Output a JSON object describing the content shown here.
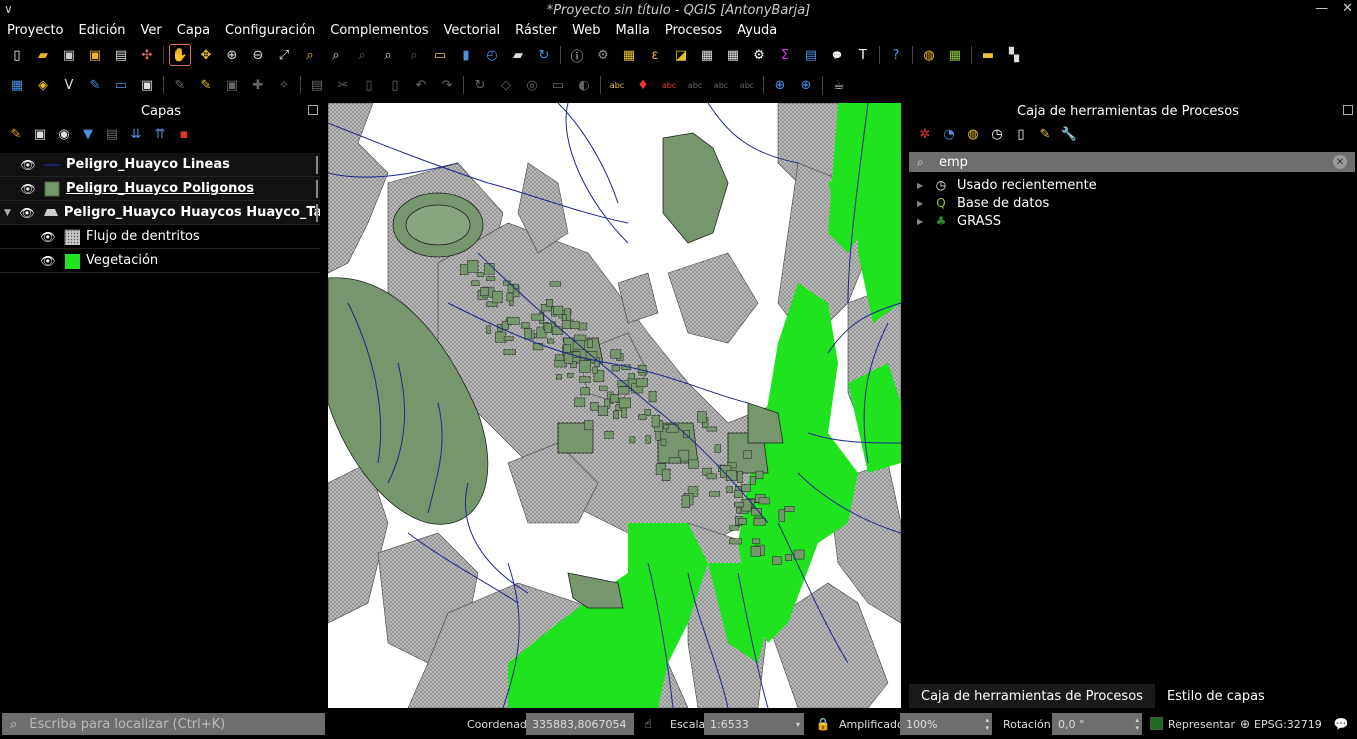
{
  "window": {
    "title": "*Proyecto sin título - QGIS [AntonyBarja]",
    "menu_glyph": "∨",
    "minimize": "—",
    "close": "✕"
  },
  "menu": {
    "items": [
      "Proyecto",
      "Edición",
      "Ver",
      "Capa",
      "Configuración",
      "Complementos",
      "Vectorial",
      "Ráster",
      "Web",
      "Malla",
      "Procesos",
      "Ayuda"
    ]
  },
  "toolbar1": {
    "icons": [
      "new-project-icon",
      "open-project-icon",
      "save-project-icon",
      "save-as-icon",
      "print-layout-icon",
      "style-manager-icon",
      "pan-icon",
      "pan-to-selection-icon",
      "zoom-in-icon",
      "zoom-out-icon",
      "zoom-full-icon",
      "zoom-to-selection-icon",
      "zoom-to-layer-icon",
      "zoom-last-icon",
      "zoom-native-icon",
      "zoom-next-icon",
      "new-map-view-icon",
      "new-3d-view-icon",
      "temporal-icon",
      "bookmarks-icon",
      "refresh-icon",
      "identify-icon",
      "measure-icon",
      "select-features-icon",
      "select-by-value-icon",
      "deselect-icon",
      "attribute-table-icon",
      "field-calculator-icon",
      "processing-toolbox-icon",
      "statistics-icon",
      "map-tips-icon",
      "annotation-icon",
      "text-annotation-icon",
      "help-icon",
      "python-console-icon",
      "plugin-icon",
      "db-manager-icon",
      "overview-icon"
    ]
  },
  "toolbar2": {
    "icons": [
      "data-source-manager-icon",
      "new-geopackage-icon",
      "new-shapefile-icon",
      "new-spatialite-icon",
      "new-virtual-layer-icon",
      "new-temp-layer-icon",
      "edit-toggle-icon",
      "digitize-icon",
      "save-edits-icon",
      "add-feature-icon",
      "vertex-tool-icon",
      "delete-icon",
      "cut-icon",
      "copy-icon",
      "paste-icon",
      "undo-icon",
      "redo-icon",
      "rotate-icon",
      "simplify-icon",
      "add-ring-icon",
      "add-part-icon",
      "fill-ring-icon",
      "label-icon",
      "pin-label-icon",
      "show-label-icon",
      "move-label-icon",
      "rotate-label-icon",
      "change-label-icon",
      "globe-icon",
      "wms-icon",
      "coffee-icon"
    ]
  },
  "layers_panel": {
    "title": "Capas",
    "layers": [
      {
        "name": "Peligro_Huayco Lineas",
        "symbol": "line",
        "color": "#1b2a8a",
        "bold": true,
        "underline": false
      },
      {
        "name": "Peligro_Huayco Poligonos",
        "symbol": "fill",
        "color": "#76966e",
        "bold": true,
        "underline": true
      },
      {
        "name": "Peligro_Huayco Huaycos Huayco_Taci",
        "symbol": "categorized",
        "color": "#cfcfcf",
        "bold": true,
        "underline": false,
        "expanded": true
      },
      {
        "name": "Flujo de dentritos",
        "symbol": "hatch",
        "color": "#9a9a9a",
        "bold": false,
        "child": true
      },
      {
        "name": "Vegetación",
        "symbol": "fill",
        "color": "#1ee31e",
        "bold": false,
        "child": true
      }
    ]
  },
  "processing": {
    "title": "Caja de herramientas de Procesos",
    "search_value": "emp",
    "tree": [
      {
        "label": "Usado recientemente",
        "icon": "clock-icon"
      },
      {
        "label": "Base de datos",
        "icon": "qgis-icon"
      },
      {
        "label": "GRASS",
        "icon": "grass-icon"
      }
    ]
  },
  "dock_tabs": [
    "Caja de herramientas de Procesos",
    "Estilo de capas"
  ],
  "statusbar": {
    "locator_placeholder": "Escriba para localizar (Ctrl+K)",
    "coord_label": "Coordenada",
    "coord_value": "335883,8067054",
    "scale_label": "Escala",
    "scale_value": "1:6533",
    "magnifier_label": "Amplificador",
    "magnifier_value": "100%",
    "rotation_label": "Rotación",
    "rotation_value": "0,0 °",
    "render_label": "Representar",
    "crs": "EPSG:32719"
  },
  "colors": {
    "hatch": "#9a9a9a",
    "vegetation": "#1ee31e",
    "polygon": "#76966e",
    "lines": "#1b2a8a"
  }
}
